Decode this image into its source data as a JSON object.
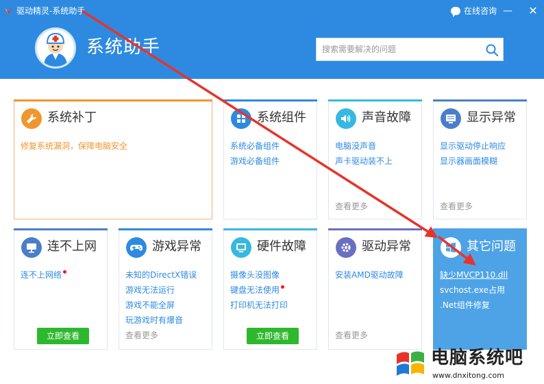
{
  "window": {
    "title": "驱动精灵-系统助手",
    "consult_label": "在线咨询",
    "minimize_glyph": "—",
    "close_glyph": "✕"
  },
  "header": {
    "title": "系统助手",
    "search_placeholder": "搜索需要解决的问题"
  },
  "colors": {
    "header_blue": "#2d8ae0",
    "link_blue": "#2d8ae0",
    "orange": "#f0962e",
    "teal": "#37b8e0",
    "green_button": "#2eb82e",
    "highlight_card": "#4ea3e6",
    "arrow_red": "#e8332a"
  },
  "cards": [
    {
      "title": "系统补丁",
      "icon": "wrench-icon",
      "links": [
        "修复系统漏洞，保障电脑安全"
      ]
    },
    {
      "title": "系统组件",
      "icon": "puzzle-icon",
      "links": [
        "系统必备组件",
        "游戏必备组件"
      ]
    },
    {
      "title": "声音故障",
      "icon": "speaker-icon",
      "links": [
        "电脑没声音",
        "声卡驱动装不上"
      ],
      "more": "查看更多"
    },
    {
      "title": "显示异常",
      "icon": "monitor-icon",
      "links": [
        "显示驱动停止响应",
        "显示器画面模糊"
      ],
      "more": "查看更多"
    },
    {
      "title": "连不上网",
      "icon": "network-icon",
      "links": [
        "连不上网络"
      ],
      "button": "立即查看"
    },
    {
      "title": "游戏异常",
      "icon": "gamepad-icon",
      "links": [
        "未知的DirectX错误",
        "游戏无法运行",
        "游戏不能全屏",
        "玩游戏时有爆音"
      ],
      "more": "查看更多"
    },
    {
      "title": "硬件故障",
      "icon": "hardware-icon",
      "links": [
        "摄像头没图像",
        "键盘无法使用",
        "打印机无法打印"
      ],
      "button": "立即查看"
    },
    {
      "title": "驱动异常",
      "icon": "gear-icon",
      "links": [
        "安装AMD驱动故障"
      ],
      "more": "查看更多"
    },
    {
      "title": "其它问题",
      "icon": "windows-icon",
      "links": [
        "缺少MVCP110.dll",
        "svchost.exe占用",
        ".Net组件修复"
      ]
    }
  ],
  "watermark": {
    "text": "电脑系统吧",
    "url": "www.dnxitong.com"
  }
}
